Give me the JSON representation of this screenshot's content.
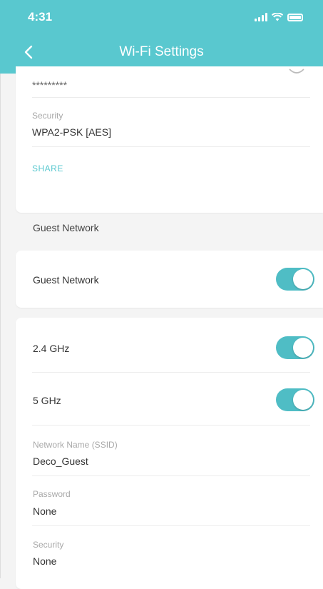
{
  "status_bar": {
    "time": "4:31"
  },
  "header": {
    "title": "Wi-Fi Settings"
  },
  "main_network": {
    "password_masked": "*********",
    "security_label": "Security",
    "security_value": "WPA2-PSK [AES]",
    "share_label": "SHARE"
  },
  "guest_section": {
    "section_label": "Guest Network",
    "guest_toggle_label": "Guest Network",
    "guest_toggle_on": true
  },
  "bands": {
    "band_24_label": "2.4 GHz",
    "band_24_on": true,
    "band_5_label": "5 GHz",
    "band_5_on": true,
    "ssid_label": "Network Name (SSID)",
    "ssid_value": "Deco_Guest",
    "password_label": "Password",
    "password_value": "None",
    "security_label": "Security",
    "security_value": "None"
  },
  "colors": {
    "accent": "#59c8cf",
    "toggle_on": "#4fbdc5",
    "background": "#f4f4f4"
  }
}
